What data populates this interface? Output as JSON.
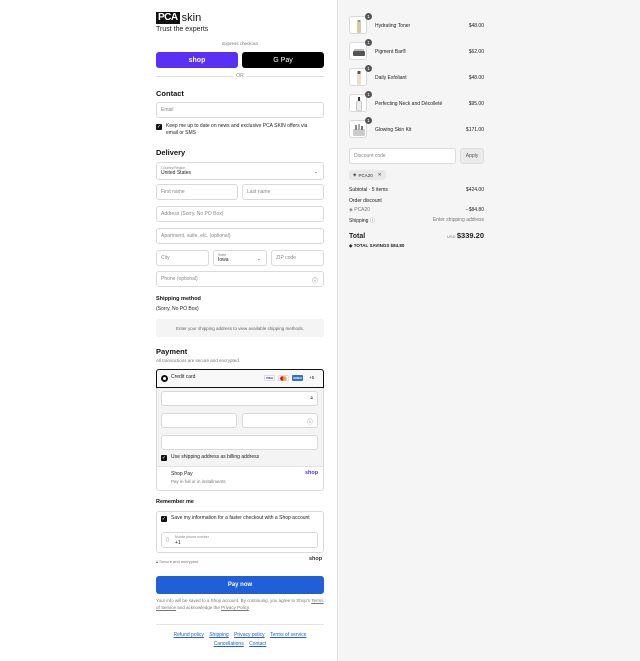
{
  "brand": {
    "logo_box": "PCA",
    "logo_skin": "skin",
    "tagline": "Trust the experts"
  },
  "express": {
    "label": "Express checkout",
    "shop_button": "shop",
    "gpay_button": "G Pay",
    "or_text": "OR"
  },
  "contact": {
    "heading": "Contact",
    "email_placeholder": "Email",
    "newsletter_label": "Keep me up to date on news and exclusive PCA SKIN offers via email or SMS"
  },
  "delivery": {
    "heading": "Delivery",
    "country_label": "Country/Region",
    "country_value": "United States",
    "first_name": "First name",
    "last_name": "Last name",
    "address": "Address (Sorry, No PO Box)",
    "apartment": "Apartment, suite, etc. (optional)",
    "city": "City",
    "state_label": "State",
    "state_value": "Iowa",
    "zip": "ZIP code",
    "phone": "Phone (optional)"
  },
  "shipping_method": {
    "heading": "Shipping method",
    "note": "(Sorry, No PO Box)",
    "info": "Enter your shipping address to view available shipping methods."
  },
  "payment": {
    "heading": "Payment",
    "subtitle": "All transactions are secure and encrypted.",
    "credit_card_label": "Credit card",
    "card_brands": [
      "VISA",
      "MC",
      "AMEX"
    ],
    "more_brands": "+5",
    "billing_label": "Use shipping address as billing address",
    "shop_pay_label": "Shop Pay",
    "shop_pay_sub": "Pay in full or in installments",
    "shop_pay_logo": "shop"
  },
  "remember": {
    "heading": "Remember me",
    "save_label": "Save my information for a faster checkout with a Shop account",
    "phone_label": "Mobile phone number",
    "phone_value": "+1",
    "secure_text": "Secure and encrypted",
    "shop_logo": "shop"
  },
  "pay_now": "Pay now",
  "legal": {
    "part1": "Your info will be saved to a Shop account. By continuing, you agree to Shop's ",
    "terms": "Terms of Service",
    "part2": " and acknowledge the ",
    "privacy": "Privacy Policy",
    "part3": "."
  },
  "footer": {
    "links_row1": [
      "Refund policy",
      "Shipping",
      "Privacy policy",
      "Terms of service"
    ],
    "links_row2": [
      "Cancellations",
      "Contact"
    ]
  },
  "cart": {
    "items": [
      {
        "name": "Hydrating Toner",
        "price": "$48.00",
        "qty": "1",
        "icon": "bottle-icon"
      },
      {
        "name": "Pigment Bar®",
        "price": "$62.00",
        "qty": "1",
        "icon": "soap-bar-icon"
      },
      {
        "name": "Daily Exfoliant",
        "price": "$48.00",
        "qty": "1",
        "icon": "bottle-icon"
      },
      {
        "name": "Perfecting Neck and Décolleté",
        "price": "$95.00",
        "qty": "1",
        "icon": "pump-bottle-icon"
      },
      {
        "name": "Glowing Skin Kit",
        "price": "$171.00",
        "qty": "1",
        "icon": "kit-icon"
      }
    ],
    "discount_placeholder": "Discount code",
    "apply": "Apply",
    "applied_code": "PCA20",
    "subtotal_label": "Subtotal · 5 items",
    "subtotal_value": "$424.00",
    "order_discount_label": "Order discount",
    "discount_code": "PCA20",
    "discount_value": "−$84.80",
    "shipping_label": "Shipping",
    "shipping_value": "Enter shipping address",
    "total_label": "Total",
    "currency": "USD",
    "total_value": "$339.20",
    "savings_label": "TOTAL SAVINGS",
    "savings_value": "$84.80"
  },
  "colors": {
    "shop_purple": "#5a31f4",
    "pay_blue": "#1f5fd8"
  }
}
